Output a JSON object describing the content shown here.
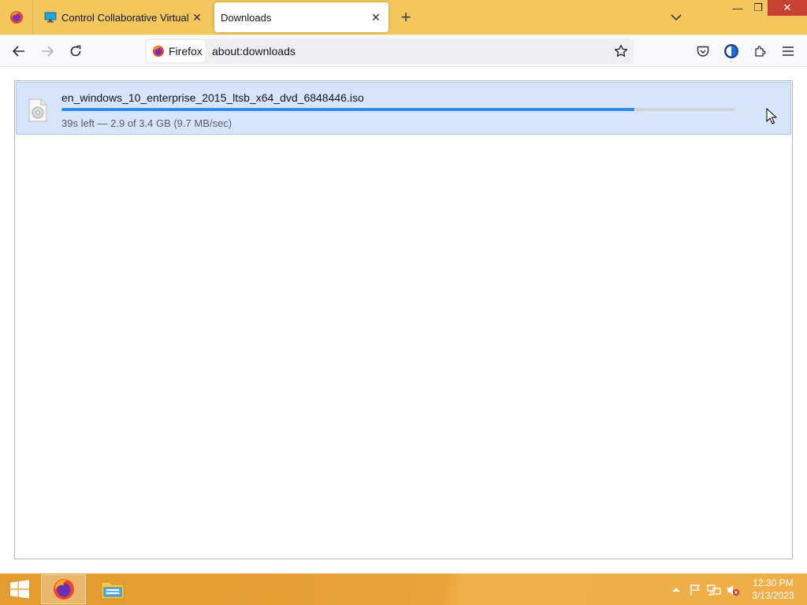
{
  "window": {
    "tabs": [
      {
        "title": "Control Collaborative Virtual M",
        "close": "✕"
      },
      {
        "title": "Downloads",
        "close": "✕"
      }
    ],
    "new_tab": "+",
    "controls": {
      "minimize": "—",
      "maximize": "❐",
      "close": "✕"
    }
  },
  "navbar": {
    "identity_label": "Firefox",
    "url": "about:downloads"
  },
  "downloads": [
    {
      "filename": "en_windows_10_enterprise_2015_ltsb_x64_dvd_6848446.iso",
      "status": "39s left — 2.9 of 3.4 GB (9.7 MB/sec)",
      "progress_fraction": 0.85
    }
  ],
  "taskbar": {
    "time": "12:30 PM",
    "date": "3/13/2023"
  },
  "colors": {
    "tabstrip": "#f4c75c",
    "selected_item": "#d6e6fa",
    "progress": "#2f8ae8",
    "taskbar": "#e9a23a"
  }
}
